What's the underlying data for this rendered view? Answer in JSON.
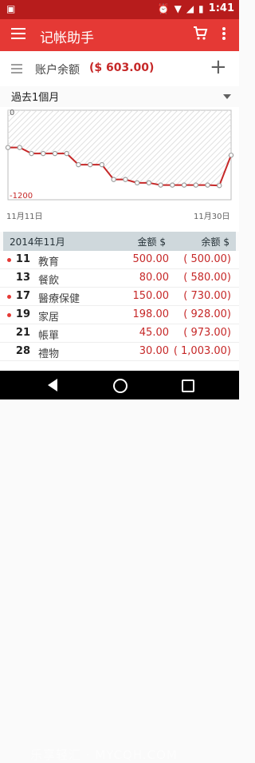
{
  "status_bar": {
    "time": "1:41"
  },
  "app_bar": {
    "title": "记帐助手"
  },
  "balance": {
    "label": "账户余额",
    "amount": "($ 603.00)"
  },
  "period": {
    "label": "過去1個月"
  },
  "chart_data": {
    "type": "line",
    "title": "",
    "xlabel": "",
    "ylabel": "",
    "y_top_label": "0",
    "y_bottom_label": "-1200",
    "x_start_label": "11月11日",
    "x_end_label": "11月30日",
    "ylim": [
      -1200,
      0
    ],
    "x": [
      11,
      12,
      13,
      14,
      15,
      16,
      17,
      18,
      19,
      20,
      21,
      22,
      23,
      24,
      25,
      26,
      27,
      28,
      29,
      30
    ],
    "values": [
      -500,
      -500,
      -580,
      -580,
      -580,
      -580,
      -730,
      -730,
      -730,
      -928,
      -928,
      -973,
      -973,
      -1003,
      -1003,
      -1003,
      -1003,
      -1003,
      -1010,
      -603
    ],
    "line_color": "#c62828",
    "grid": false
  },
  "table": {
    "headers": {
      "month": "2014年11月",
      "amount": "金额 $",
      "balance": "余额 $"
    },
    "rows": [
      {
        "dot": true,
        "day": "11",
        "category": "教育",
        "amount": "500.00",
        "balance": "( 500.00)"
      },
      {
        "dot": false,
        "day": "13",
        "category": "餐飲",
        "amount": "80.00",
        "balance": "( 580.00)"
      },
      {
        "dot": true,
        "day": "17",
        "category": "醫療保健",
        "amount": "150.00",
        "balance": "( 730.00)"
      },
      {
        "dot": true,
        "day": "19",
        "category": "家居",
        "amount": "198.00",
        "balance": "( 928.00)"
      },
      {
        "dot": false,
        "day": "21",
        "category": "帳單",
        "amount": "45.00",
        "balance": "( 973.00)"
      },
      {
        "dot": false,
        "day": "28",
        "category": "禮物",
        "amount": "30.00",
        "balance": "( 1,003.00)"
      }
    ]
  },
  "watermark": "乐享轻汇 · MYCQH.COM"
}
